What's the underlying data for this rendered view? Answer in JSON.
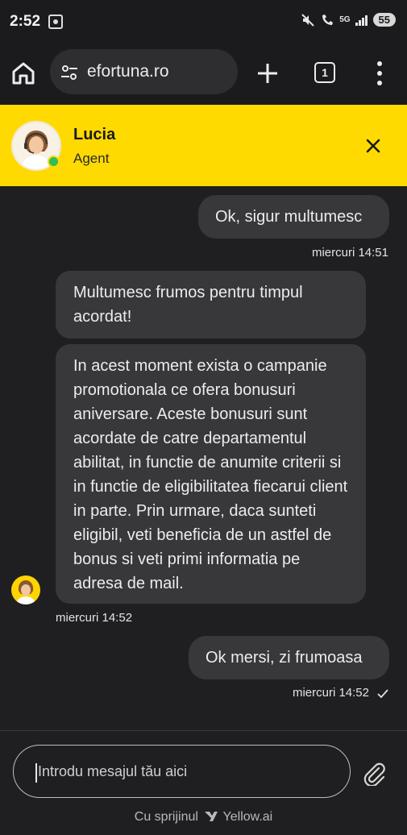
{
  "status": {
    "time": "2:52",
    "battery": "55",
    "network": "5G"
  },
  "browser": {
    "url": "efortuna.ro",
    "tab_count": "1"
  },
  "agent": {
    "name": "Lucia",
    "role": "Agent"
  },
  "messages": [
    {
      "from": "user",
      "text": "Ok, sigur multumesc",
      "time": "miercuri 14:51"
    },
    {
      "from": "agent",
      "text": "Multumesc frumos pentru timpul acordat!"
    },
    {
      "from": "agent",
      "text": "In acest moment exista o campanie promotionala ce ofera bonusuri aniversare. Aceste bonusuri sunt acordate de catre departamentul abilitat, in functie de anumite criterii si in functie de eligibilitatea fiecarui client in parte. Prin urmare, daca sunteti eligibil, veti beneficia de un astfel de bonus si veti primi informatia pe adresa de mail.",
      "time": "miercuri 14:52"
    },
    {
      "from": "user",
      "text": "Ok mersi, zi frumoasa",
      "time": "miercuri 14:52",
      "status_icon": "check-icon"
    }
  ],
  "composer": {
    "placeholder": "Introdu mesajul tău aici",
    "powered_by": "Cu sprijinul",
    "brand": "Yellow.ai"
  }
}
